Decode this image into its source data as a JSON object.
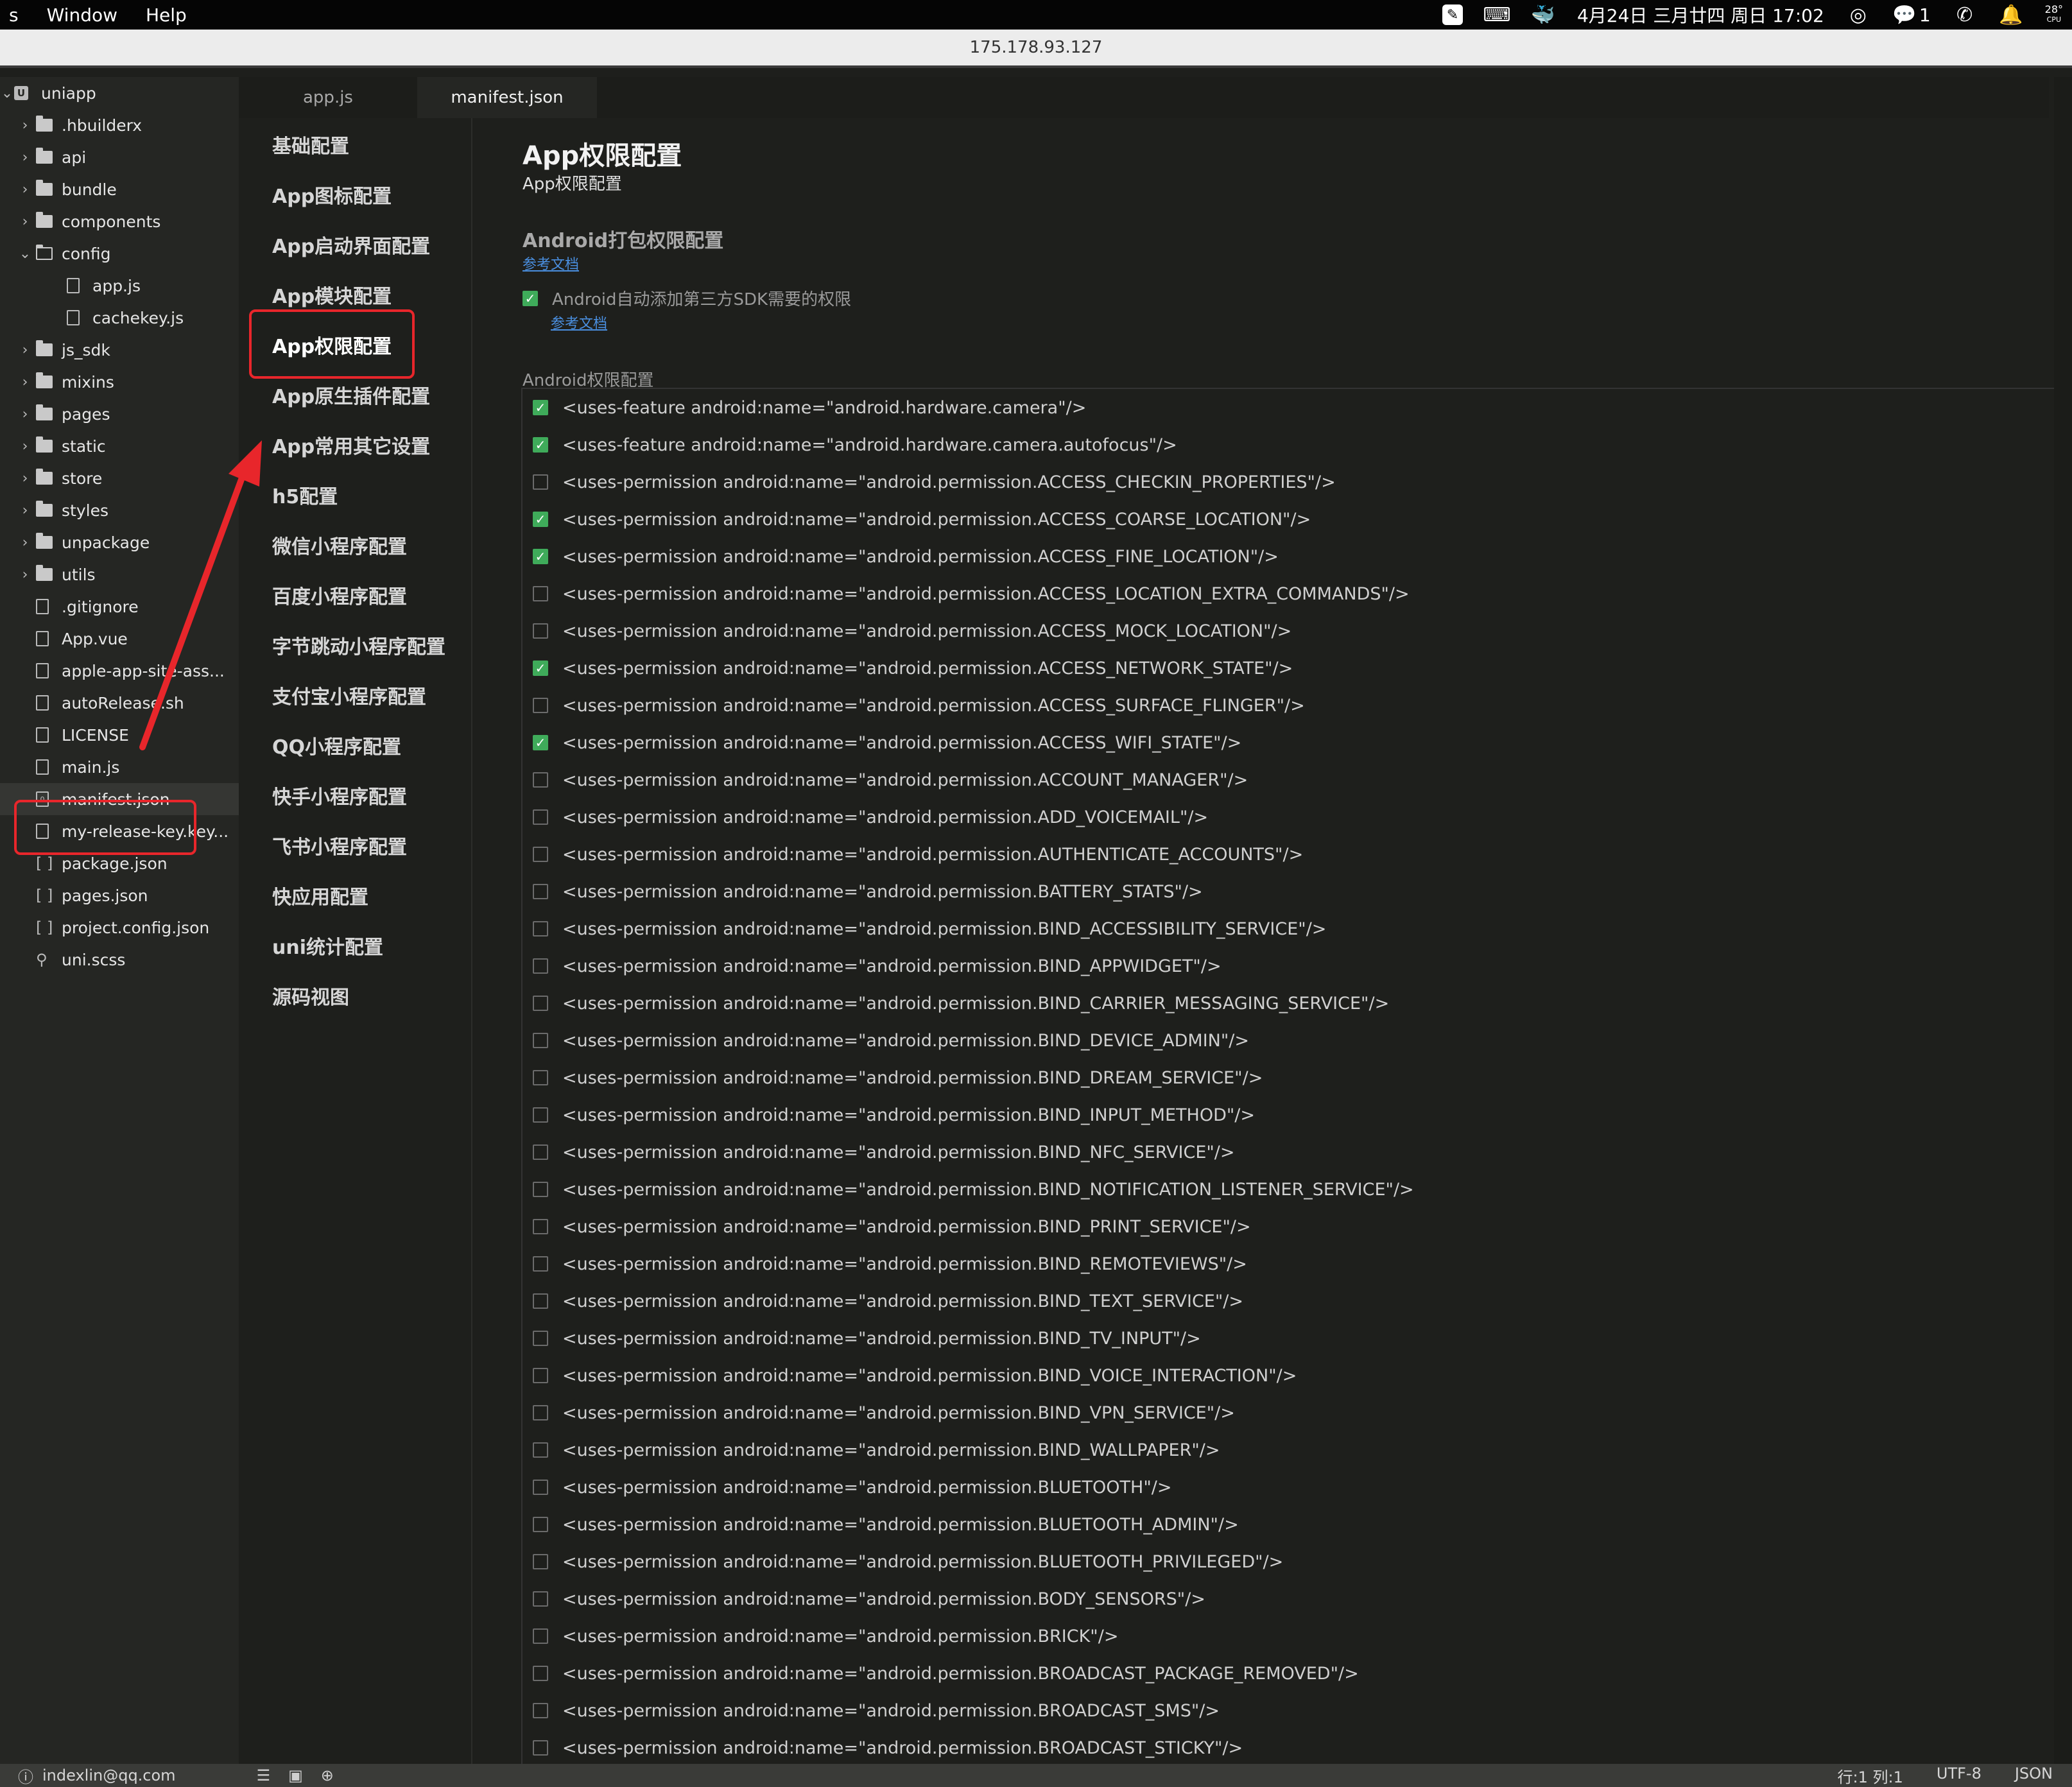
{
  "menubar": {
    "items": [
      "s",
      "Window",
      "Help"
    ],
    "datetime": "4月24日 三月廿四 周日 17:02",
    "notifications_count": "1",
    "cpu_label_top": "28°",
    "cpu_label_bottom": "CPU"
  },
  "address": "175.178.93.127",
  "tabs": [
    {
      "label": "app.js",
      "active": false
    },
    {
      "label": "manifest.json",
      "active": true
    }
  ],
  "tree": {
    "root": "uniapp",
    "items": [
      {
        "label": ".hbuilderx",
        "type": "folder"
      },
      {
        "label": "api",
        "type": "folder"
      },
      {
        "label": "bundle",
        "type": "folder"
      },
      {
        "label": "components",
        "type": "folder"
      },
      {
        "label": "config",
        "type": "folder-open"
      },
      {
        "label": "app.js",
        "type": "file-child"
      },
      {
        "label": "cachekey.js",
        "type": "file-child"
      },
      {
        "label": "js_sdk",
        "type": "folder"
      },
      {
        "label": "mixins",
        "type": "folder"
      },
      {
        "label": "pages",
        "type": "folder"
      },
      {
        "label": "static",
        "type": "folder"
      },
      {
        "label": "store",
        "type": "folder"
      },
      {
        "label": "styles",
        "type": "folder"
      },
      {
        "label": "unpackage",
        "type": "folder"
      },
      {
        "label": "utils",
        "type": "folder"
      },
      {
        "label": ".gitignore",
        "type": "file"
      },
      {
        "label": "App.vue",
        "type": "file"
      },
      {
        "label": "apple-app-site-ass...",
        "type": "file"
      },
      {
        "label": "autoRelease.sh",
        "type": "file"
      },
      {
        "label": "LICENSE",
        "type": "file"
      },
      {
        "label": "main.js",
        "type": "file"
      },
      {
        "label": "manifest.json",
        "type": "json",
        "selected": true
      },
      {
        "label": "my-release-key.key...",
        "type": "file"
      },
      {
        "label": "package.json",
        "type": "bracket"
      },
      {
        "label": "pages.json",
        "type": "bracket"
      },
      {
        "label": "project.config.json",
        "type": "bracket"
      },
      {
        "label": "uni.scss",
        "type": "scss"
      }
    ]
  },
  "nav": {
    "items": [
      "基础配置",
      "App图标配置",
      "App启动界面配置",
      "App模块配置",
      "App权限配置",
      "App原生插件配置",
      "App常用其它设置",
      "h5配置",
      "微信小程序配置",
      "百度小程序配置",
      "字节跳动小程序配置",
      "支付宝小程序配置",
      "QQ小程序配置",
      "快手小程序配置",
      "飞书小程序配置",
      "快应用配置",
      "uni统计配置",
      "源码视图"
    ],
    "active_index": 4
  },
  "content": {
    "title": "App权限配置",
    "subtitle": "App权限配置",
    "section_title": "Android打包权限配置",
    "doc_link": "参考文档",
    "sdk_option": {
      "label": "Android自动添加第三方SDK需要的权限",
      "checked": true,
      "doc_link": "参考文档"
    },
    "perm_label": "Android权限配置",
    "permissions": [
      {
        "text": "<uses-feature android:name=\"android.hardware.camera\"/>",
        "checked": true
      },
      {
        "text": "<uses-feature android:name=\"android.hardware.camera.autofocus\"/>",
        "checked": true
      },
      {
        "text": "<uses-permission android:name=\"android.permission.ACCESS_CHECKIN_PROPERTIES\"/>",
        "checked": false
      },
      {
        "text": "<uses-permission android:name=\"android.permission.ACCESS_COARSE_LOCATION\"/>",
        "checked": true
      },
      {
        "text": "<uses-permission android:name=\"android.permission.ACCESS_FINE_LOCATION\"/>",
        "checked": true
      },
      {
        "text": "<uses-permission android:name=\"android.permission.ACCESS_LOCATION_EXTRA_COMMANDS\"/>",
        "checked": false
      },
      {
        "text": "<uses-permission android:name=\"android.permission.ACCESS_MOCK_LOCATION\"/>",
        "checked": false
      },
      {
        "text": "<uses-permission android:name=\"android.permission.ACCESS_NETWORK_STATE\"/>",
        "checked": true
      },
      {
        "text": "<uses-permission android:name=\"android.permission.ACCESS_SURFACE_FLINGER\"/>",
        "checked": false
      },
      {
        "text": "<uses-permission android:name=\"android.permission.ACCESS_WIFI_STATE\"/>",
        "checked": true
      },
      {
        "text": "<uses-permission android:name=\"android.permission.ACCOUNT_MANAGER\"/>",
        "checked": false
      },
      {
        "text": "<uses-permission android:name=\"android.permission.ADD_VOICEMAIL\"/>",
        "checked": false
      },
      {
        "text": "<uses-permission android:name=\"android.permission.AUTHENTICATE_ACCOUNTS\"/>",
        "checked": false
      },
      {
        "text": "<uses-permission android:name=\"android.permission.BATTERY_STATS\"/>",
        "checked": false
      },
      {
        "text": "<uses-permission android:name=\"android.permission.BIND_ACCESSIBILITY_SERVICE\"/>",
        "checked": false
      },
      {
        "text": "<uses-permission android:name=\"android.permission.BIND_APPWIDGET\"/>",
        "checked": false
      },
      {
        "text": "<uses-permission android:name=\"android.permission.BIND_CARRIER_MESSAGING_SERVICE\"/>",
        "checked": false
      },
      {
        "text": "<uses-permission android:name=\"android.permission.BIND_DEVICE_ADMIN\"/>",
        "checked": false
      },
      {
        "text": "<uses-permission android:name=\"android.permission.BIND_DREAM_SERVICE\"/>",
        "checked": false
      },
      {
        "text": "<uses-permission android:name=\"android.permission.BIND_INPUT_METHOD\"/>",
        "checked": false
      },
      {
        "text": "<uses-permission android:name=\"android.permission.BIND_NFC_SERVICE\"/>",
        "checked": false
      },
      {
        "text": "<uses-permission android:name=\"android.permission.BIND_NOTIFICATION_LISTENER_SERVICE\"/>",
        "checked": false
      },
      {
        "text": "<uses-permission android:name=\"android.permission.BIND_PRINT_SERVICE\"/>",
        "checked": false
      },
      {
        "text": "<uses-permission android:name=\"android.permission.BIND_REMOTEVIEWS\"/>",
        "checked": false
      },
      {
        "text": "<uses-permission android:name=\"android.permission.BIND_TEXT_SERVICE\"/>",
        "checked": false
      },
      {
        "text": "<uses-permission android:name=\"android.permission.BIND_TV_INPUT\"/>",
        "checked": false
      },
      {
        "text": "<uses-permission android:name=\"android.permission.BIND_VOICE_INTERACTION\"/>",
        "checked": false
      },
      {
        "text": "<uses-permission android:name=\"android.permission.BIND_VPN_SERVICE\"/>",
        "checked": false
      },
      {
        "text": "<uses-permission android:name=\"android.permission.BIND_WALLPAPER\"/>",
        "checked": false
      },
      {
        "text": "<uses-permission android:name=\"android.permission.BLUETOOTH\"/>",
        "checked": false
      },
      {
        "text": "<uses-permission android:name=\"android.permission.BLUETOOTH_ADMIN\"/>",
        "checked": false
      },
      {
        "text": "<uses-permission android:name=\"android.permission.BLUETOOTH_PRIVILEGED\"/>",
        "checked": false
      },
      {
        "text": "<uses-permission android:name=\"android.permission.BODY_SENSORS\"/>",
        "checked": false
      },
      {
        "text": "<uses-permission android:name=\"android.permission.BRICK\"/>",
        "checked": false
      },
      {
        "text": "<uses-permission android:name=\"android.permission.BROADCAST_PACKAGE_REMOVED\"/>",
        "checked": false
      },
      {
        "text": "<uses-permission android:name=\"android.permission.BROADCAST_SMS\"/>",
        "checked": false
      },
      {
        "text": "<uses-permission android:name=\"android.permission.BROADCAST_STICKY\"/>",
        "checked": false
      }
    ]
  },
  "statusbar": {
    "user": "indexlin@qq.com",
    "position": "行:1  列:1",
    "encoding": "UTF-8",
    "language": "JSON"
  },
  "colors": {
    "accent_check": "#3fab5a",
    "annotation_red": "#e8262b",
    "link": "#4a8fe0"
  }
}
